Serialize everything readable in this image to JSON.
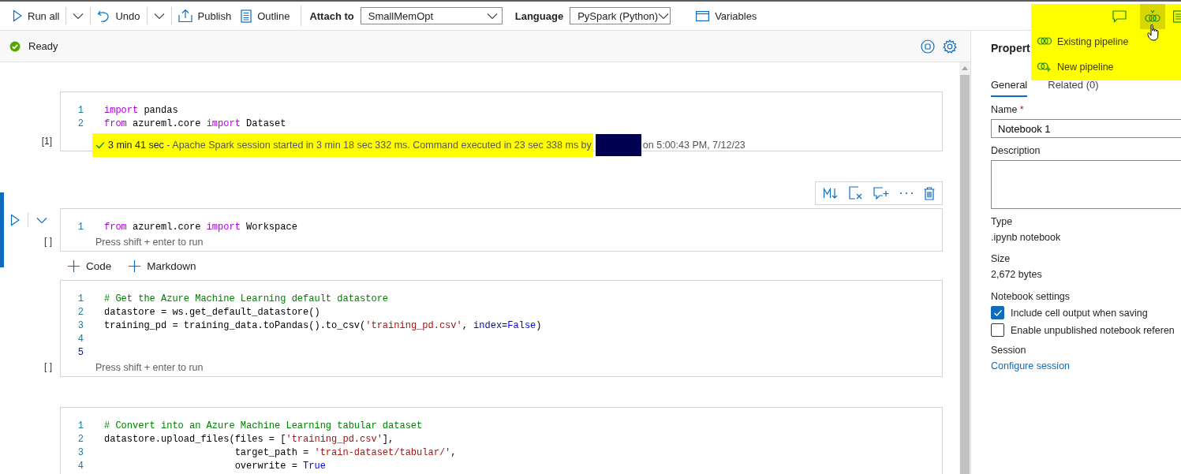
{
  "toolbar": {
    "items": [
      {
        "kind": "run",
        "label": "Run all"
      },
      {
        "kind": "split"
      },
      {
        "kind": "undo",
        "label": "Undo"
      },
      {
        "kind": "split"
      },
      {
        "kind": "publish",
        "label": "Publish"
      },
      {
        "kind": "outline",
        "label": "Outline"
      }
    ],
    "attach": {
      "label": "Attach to",
      "value": "SmallMemOpt"
    },
    "language": {
      "label": "Language",
      "value": "PySpark (Python)"
    },
    "variables": {
      "label": "Variables"
    }
  },
  "status": {
    "text": "Ready"
  },
  "cells": [
    {
      "selected": false,
      "count": "[1]",
      "lines": [
        {
          "n": "1",
          "current": false,
          "tokens": [
            {
              "kind": "kw",
              "text": "import"
            },
            {
              "kind": "plain",
              "text": " pandas"
            }
          ]
        },
        {
          "n": "2",
          "current": false,
          "tokens": [
            {
              "kind": "kw",
              "text": "from"
            },
            {
              "kind": "plain",
              "text": " azureml.core "
            },
            {
              "kind": "kw",
              "text": "import"
            },
            {
              "kind": "plain",
              "text": " Dataset"
            }
          ]
        }
      ],
      "output": {
        "highlighted": true,
        "redacted": true,
        "duration": "3 min 41 sec",
        "message": "- Apache Spark session started in 3 min 18 sec 332 ms. Command executed in 23 sec 338 ms by",
        "timestamp": "on 5:00:43 PM, 7/12/23"
      }
    },
    {
      "selected": true,
      "count": "[ ]",
      "hint": "Press shift + enter to run",
      "lines": [
        {
          "n": "1",
          "current": false,
          "tokens": [
            {
              "kind": "kw",
              "text": "from"
            },
            {
              "kind": "plain",
              "text": " azureml.core "
            },
            {
              "kind": "kw",
              "text": "import"
            },
            {
              "kind": "plain",
              "text": " Workspace"
            }
          ]
        }
      ]
    },
    {
      "selected": false,
      "count": "[ ]",
      "hint": "Press shift + enter to run",
      "lines": [
        {
          "n": "1",
          "current": false,
          "tokens": [
            {
              "kind": "comment",
              "text": "# Get the Azure Machine Learning default datastore"
            }
          ]
        },
        {
          "n": "2",
          "current": false,
          "tokens": [
            {
              "kind": "plain",
              "text": "datastore = ws.get_default_datastore()"
            }
          ]
        },
        {
          "n": "3",
          "current": false,
          "tokens": [
            {
              "kind": "plain",
              "text": "training_pd = training_data.toPandas().to_csv("
            },
            {
              "kind": "string",
              "text": "'training_pd.csv'"
            },
            {
              "kind": "plain",
              "text": ", "
            },
            {
              "kind": "param",
              "text": "index"
            },
            {
              "kind": "plain",
              "text": "="
            },
            {
              "kind": "const",
              "text": "False"
            },
            {
              "kind": "plain",
              "text": ")"
            }
          ]
        },
        {
          "n": "4",
          "current": false
        },
        {
          "n": "5",
          "current": true
        }
      ]
    },
    {
      "selected": false,
      "lines": [
        {
          "n": "1",
          "current": false,
          "tokens": [
            {
              "kind": "comment",
              "text": "# Convert into an Azure Machine Learning tabular dataset"
            }
          ]
        },
        {
          "n": "2",
          "current": false,
          "tokens": [
            {
              "kind": "plain",
              "text": "datastore.upload_files(files = ["
            },
            {
              "kind": "string",
              "text": "'training_pd.csv'"
            },
            {
              "kind": "plain",
              "text": "],"
            }
          ]
        },
        {
          "n": "3",
          "current": false,
          "tokens": [
            {
              "kind": "plain",
              "text": "                       target_path = "
            },
            {
              "kind": "string",
              "text": "'train-dataset/tabular/'"
            },
            {
              "kind": "plain",
              "text": ","
            }
          ]
        },
        {
          "n": "4",
          "current": false,
          "tokens": [
            {
              "kind": "plain",
              "text": "                       overwrite = "
            },
            {
              "kind": "const",
              "text": "True"
            }
          ]
        }
      ]
    }
  ],
  "add_cell": [
    {
      "label": "Code"
    },
    {
      "label": "Markdown"
    }
  ],
  "properties": {
    "title": "Propert",
    "tabs": [
      {
        "label": "General",
        "selected": true
      },
      {
        "label": "Related (0)",
        "selected": false
      }
    ],
    "name": {
      "label": "Name",
      "required": "*",
      "value": "Notebook 1"
    },
    "description": {
      "label": "Description"
    },
    "type": {
      "label": "Type",
      "value": ".ipynb notebook"
    },
    "size": {
      "label": "Size",
      "value": "2,672 bytes"
    },
    "settings": {
      "label": "Notebook settings",
      "options": [
        {
          "label": "Include cell output when saving",
          "checked": true
        },
        {
          "label": "Enable unpublished notebook referen",
          "checked": false
        }
      ]
    },
    "session": {
      "label": "Session",
      "link": "Configure session"
    }
  },
  "pipeline_menu": {
    "header_icons": [
      {
        "kind": "comment",
        "active": false
      },
      {
        "kind": "pipeline",
        "active": true
      },
      {
        "kind": "list",
        "active": false
      }
    ],
    "items": [
      {
        "kind": "existing",
        "label": "Existing pipeline"
      },
      {
        "kind": "new",
        "label": "New pipeline"
      }
    ]
  }
}
